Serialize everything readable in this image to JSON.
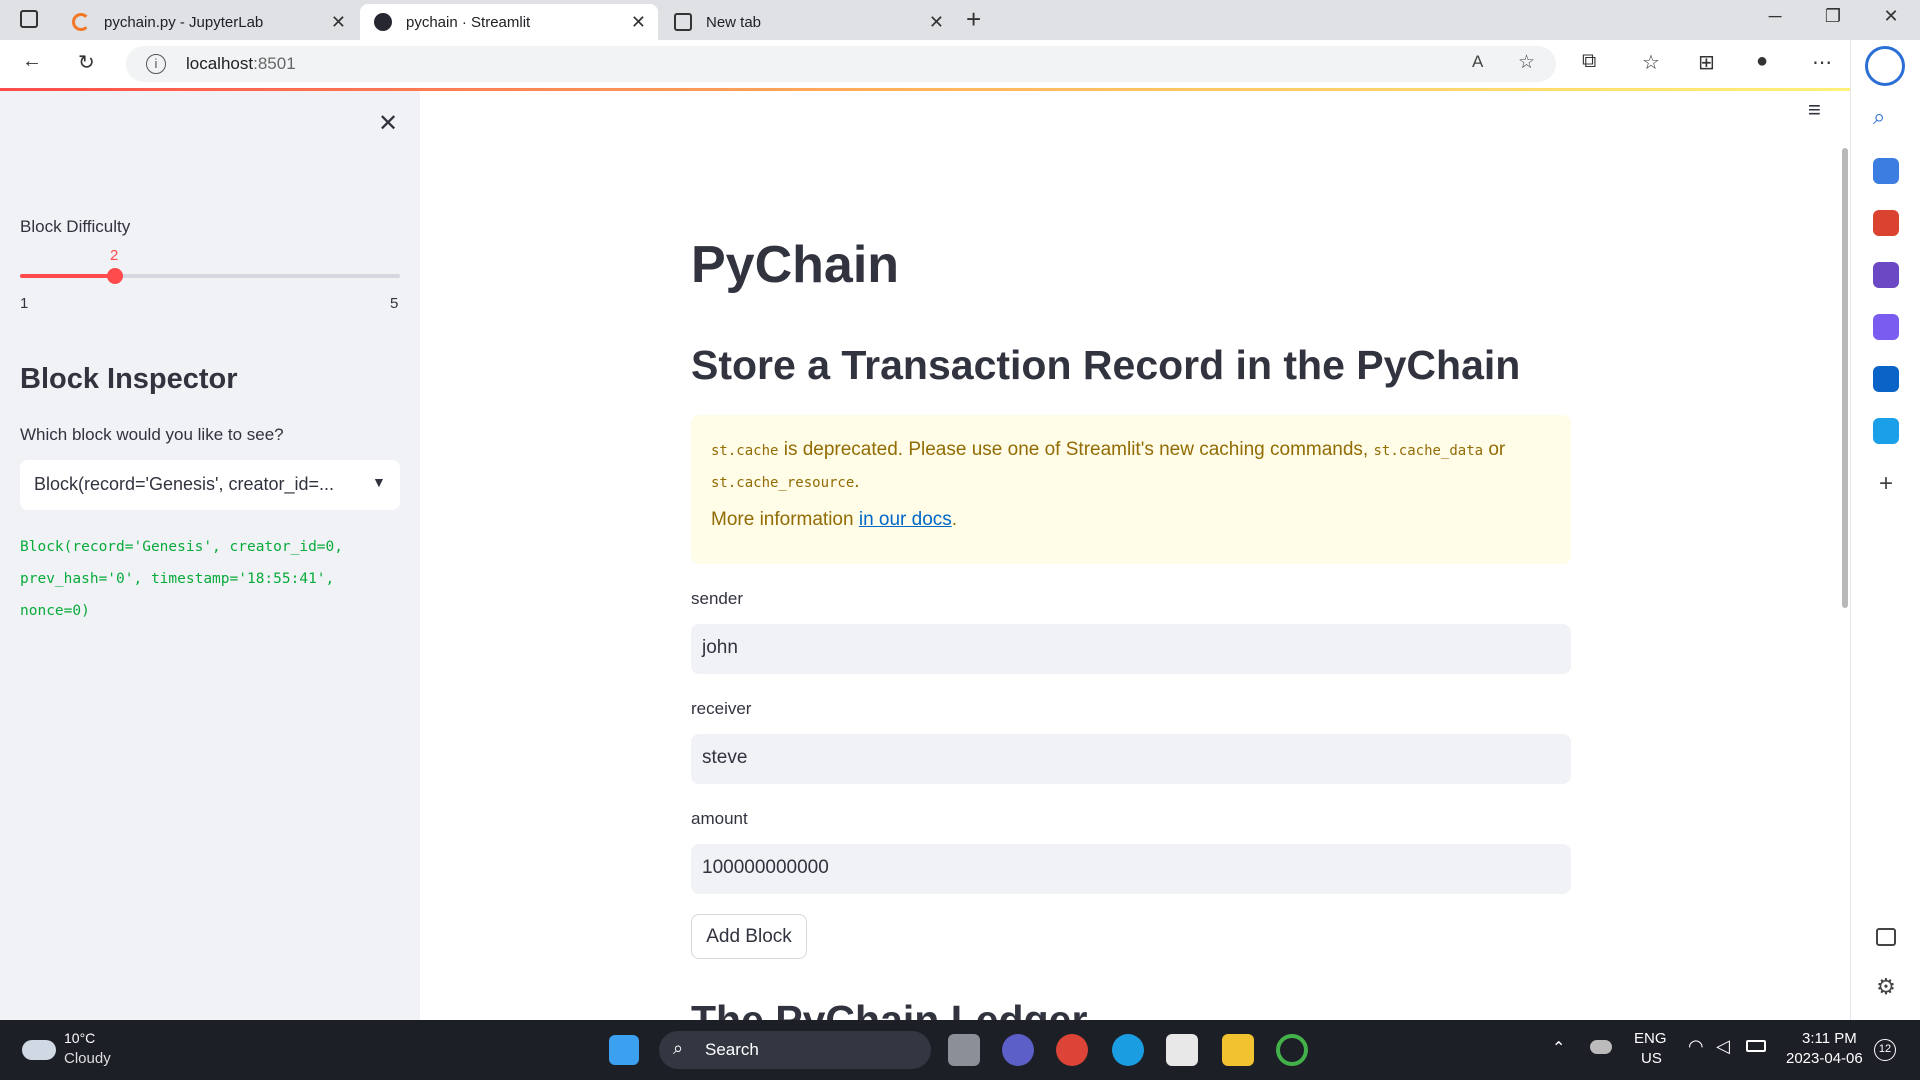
{
  "browser": {
    "tabs": [
      {
        "label": "pychain.py - JupyterLab"
      },
      {
        "label": "pychain · Streamlit"
      },
      {
        "label": "New tab"
      }
    ],
    "url_host": "localhost",
    "url_port": ":8501"
  },
  "sidebar": {
    "slider": {
      "label": "Block Difficulty",
      "value": "2",
      "min": "1",
      "max": "5",
      "fraction": 0.25
    },
    "inspector_title": "Block Inspector",
    "select_label": "Which block would you like to see?",
    "select_value": "Block(record='Genesis', creator_id=...",
    "block_code": "Block(record='Genesis', creator_id=0,\nprev_hash='0', timestamp='18:55:41',\nnonce=0)"
  },
  "main": {
    "title": "PyChain",
    "subtitle": "Store a Transaction Record in the PyChain",
    "warning": {
      "code1": "st.cache",
      "text1": " is deprecated. Please use one of Streamlit's new caching commands, ",
      "code2": "st.cache_data",
      "text2": " or",
      "code3": "st.cache_resource",
      "text3": ".",
      "more": "More information ",
      "link": "in our docs",
      "dot": "."
    },
    "fields": [
      {
        "label": "sender",
        "value": "john"
      },
      {
        "label": "receiver",
        "value": "steve"
      },
      {
        "label": "amount",
        "value": "100000000000"
      }
    ],
    "add_button": "Add Block",
    "ledger_heading": "The PyChain Ledger"
  },
  "taskbar": {
    "weather_temp": "10°C",
    "weather_desc": "Cloudy",
    "search": "Search",
    "lang": "ENG",
    "region": "US",
    "time": "3:11 PM",
    "date": "2023-04-06",
    "notif_count": "12"
  },
  "colors": {
    "accent": "#ff4b4b",
    "warning_bg": "#fffce7",
    "warning_text": "#926c05",
    "code_green": "#09ab3b"
  }
}
